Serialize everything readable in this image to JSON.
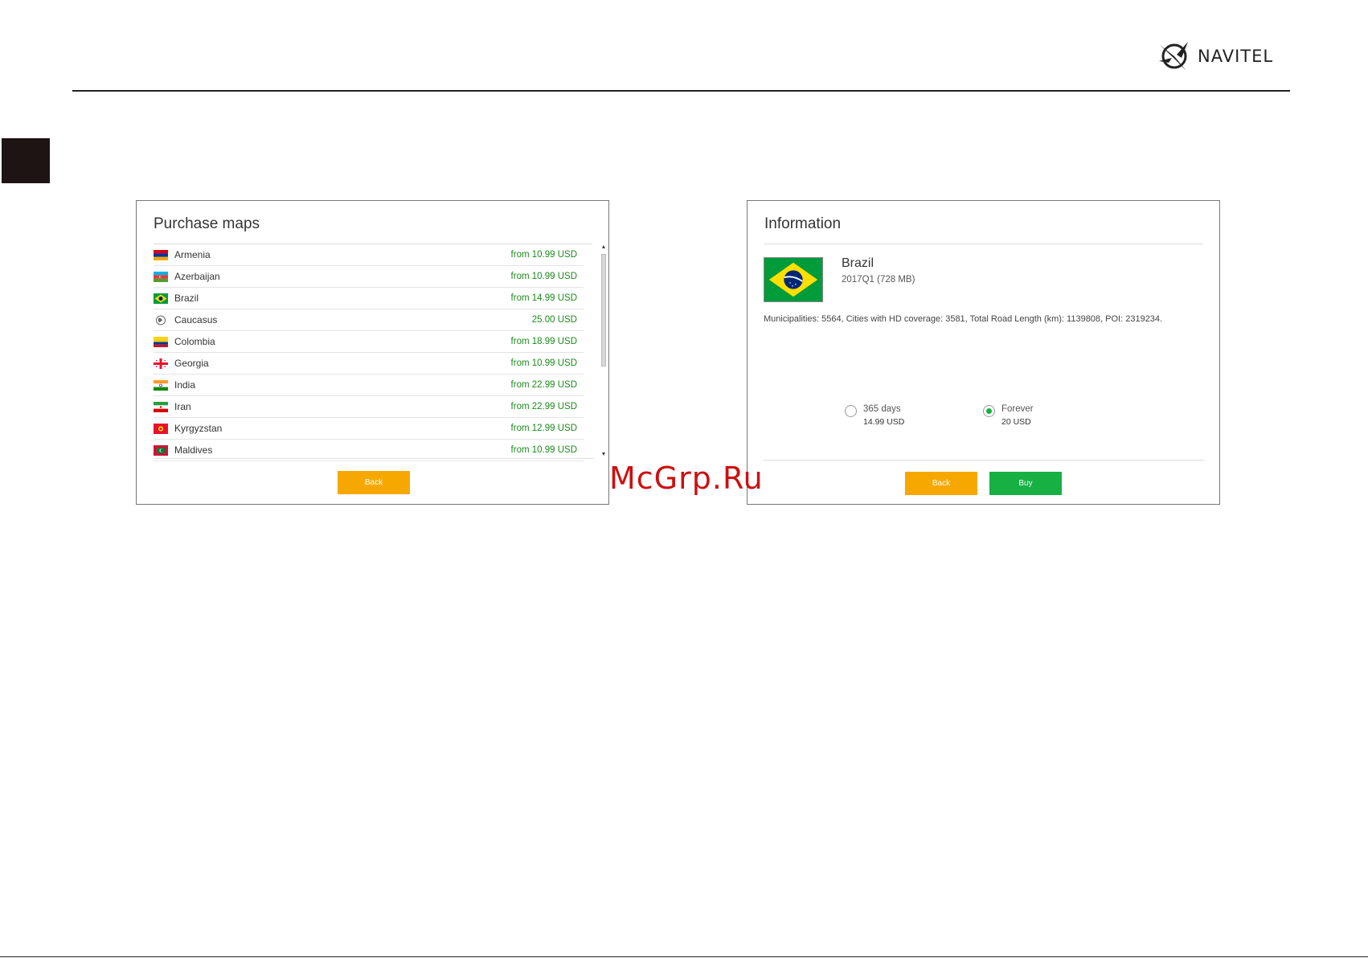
{
  "brand": {
    "name": "NAVITEL",
    "icon": "navitel-logo-icon"
  },
  "watermark": "McGrp.Ru",
  "purchase_maps": {
    "title": "Purchase maps",
    "items": [
      {
        "country": "Armenia",
        "price": "from 10.99 USD",
        "flag": "armenia-flag-icon"
      },
      {
        "country": "Azerbaijan",
        "price": "from 10.99 USD",
        "flag": "azerbaijan-flag-icon"
      },
      {
        "country": "Brazil",
        "price": "from 14.99 USD",
        "flag": "brazil-flag-icon"
      },
      {
        "country": "Caucasus",
        "price": "25.00 USD",
        "flag": "globe-icon"
      },
      {
        "country": "Colombia",
        "price": "from 18.99 USD",
        "flag": "colombia-flag-icon"
      },
      {
        "country": "Georgia",
        "price": "from 10.99 USD",
        "flag": "georgia-flag-icon"
      },
      {
        "country": "India",
        "price": "from 22.99 USD",
        "flag": "india-flag-icon"
      },
      {
        "country": "Iran",
        "price": "from 22.99 USD",
        "flag": "iran-flag-icon"
      },
      {
        "country": "Kyrgyzstan",
        "price": "from 12.99 USD",
        "flag": "kyrgyzstan-flag-icon"
      },
      {
        "country": "Maldives",
        "price": "from 10.99 USD",
        "flag": "maldives-flag-icon"
      }
    ],
    "back_label": "Back"
  },
  "information": {
    "title": "Information",
    "name": "Brazil",
    "version": "2017Q1 (728 MB)",
    "stats": "Municipalities: 5564, Cities with HD coverage: 3581, Total Road Length (km): 1139808, POI: 2319234.",
    "options": [
      {
        "label": "365 days",
        "price": "14.99 USD",
        "selected": false
      },
      {
        "label": "Forever",
        "price": "20 USD",
        "selected": true
      }
    ],
    "back_label": "Back",
    "buy_label": "Buy"
  },
  "colors": {
    "orange": "#f7a800",
    "green": "#16b043",
    "price_green": "#1a8a1a"
  }
}
